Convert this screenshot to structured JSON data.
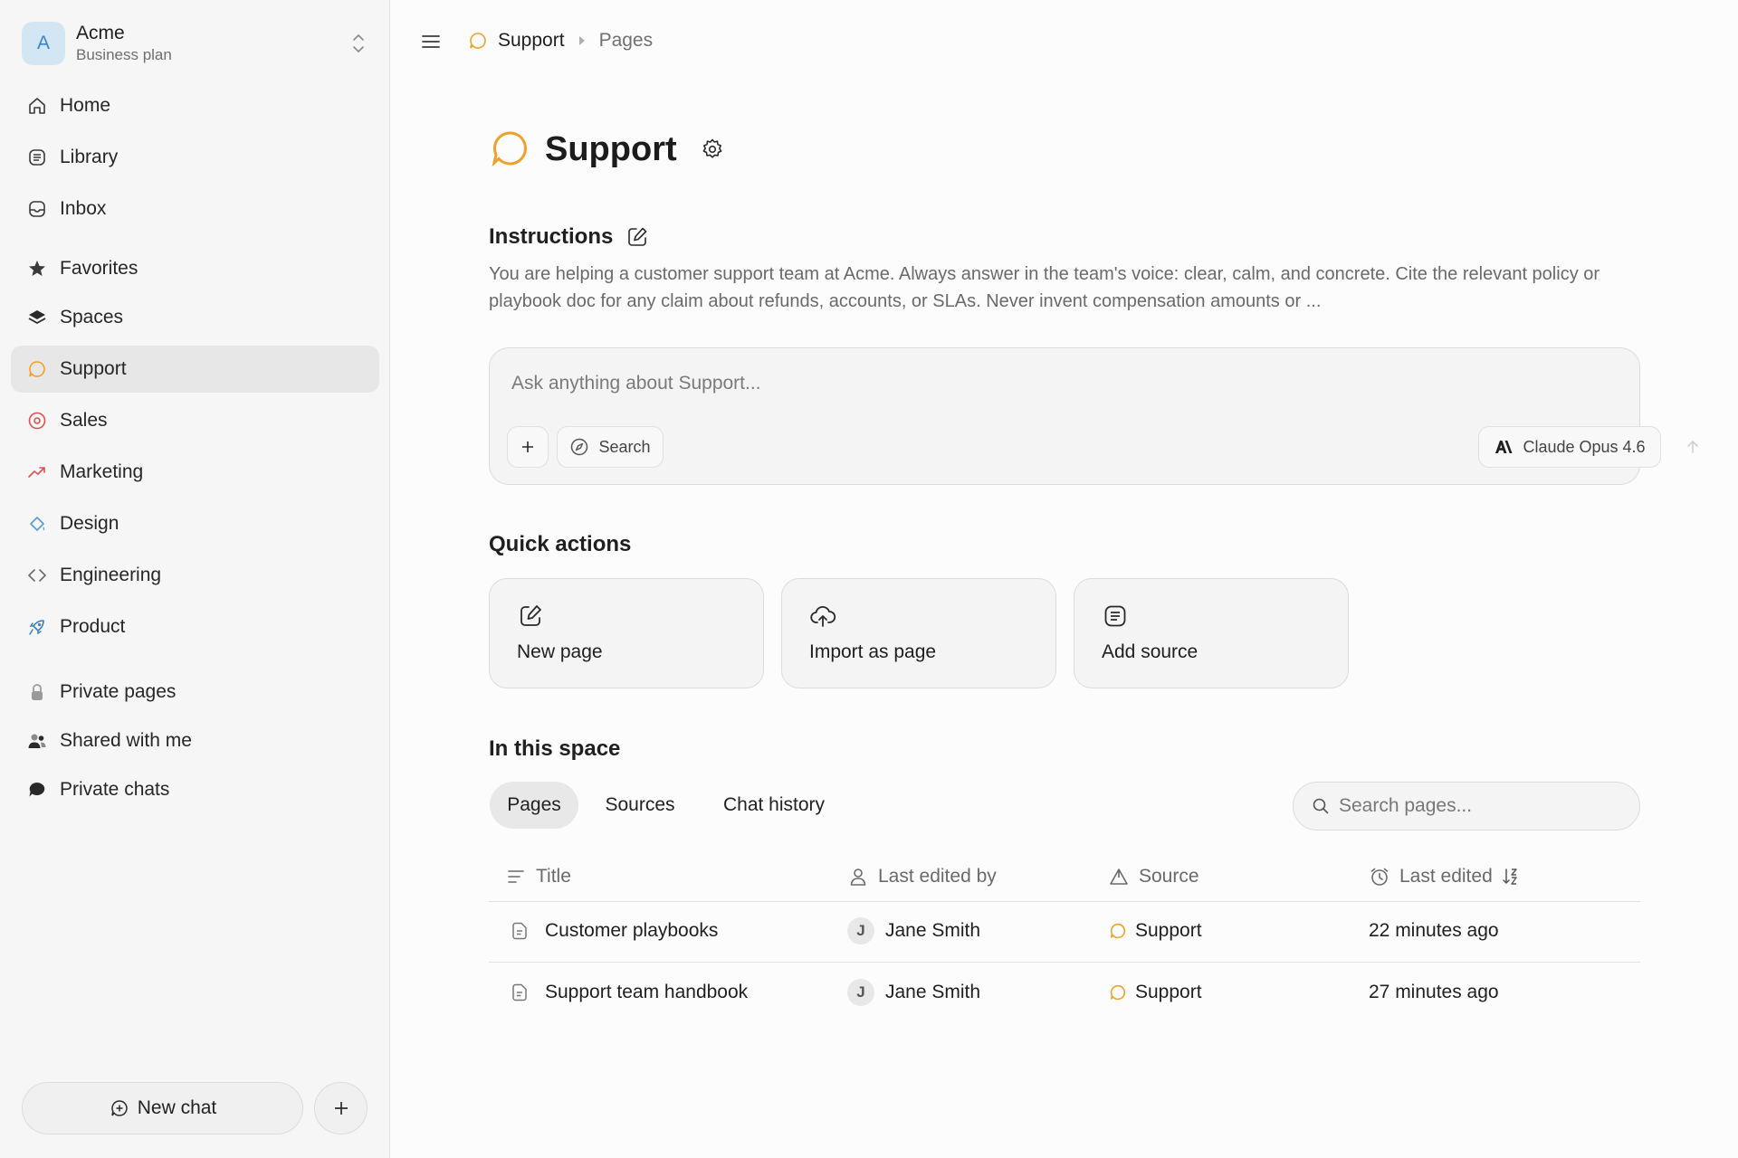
{
  "workspace": {
    "avatar_letter": "A",
    "name": "Acme",
    "plan": "Business plan"
  },
  "sidebar": {
    "items": [
      {
        "label": "Home",
        "icon": "home-icon"
      },
      {
        "label": "Library",
        "icon": "library-icon"
      },
      {
        "label": "Inbox",
        "icon": "inbox-icon"
      },
      {
        "label": "Favorites",
        "icon": "star-icon"
      },
      {
        "label": "Spaces",
        "icon": "layers-icon"
      },
      {
        "label": "Support",
        "icon": "chat-bubble-icon",
        "active": true
      },
      {
        "label": "Sales",
        "icon": "target-icon"
      },
      {
        "label": "Marketing",
        "icon": "trend-up-icon"
      },
      {
        "label": "Design",
        "icon": "paint-icon"
      },
      {
        "label": "Engineering",
        "icon": "code-icon"
      },
      {
        "label": "Product",
        "icon": "rocket-icon"
      },
      {
        "label": "Private pages",
        "icon": "lock-icon"
      },
      {
        "label": "Shared with me",
        "icon": "users-icon"
      },
      {
        "label": "Private chats",
        "icon": "chat-filled-icon"
      }
    ],
    "new_chat_label": "New chat"
  },
  "breadcrumb": {
    "space": "Support",
    "page": "Pages"
  },
  "space": {
    "title": "Support"
  },
  "instructions": {
    "heading": "Instructions",
    "text": "You are helping a customer support team at Acme. Always answer in the team's voice: clear, calm, and concrete. Cite the relevant policy or playbook doc for any claim about refunds, accounts, or SLAs. Never invent compensation amounts or ..."
  },
  "composer": {
    "placeholder": "Ask anything about Support...",
    "search_label": "Search",
    "model_label": "Claude Opus 4.6"
  },
  "quick_actions": {
    "heading": "Quick actions",
    "items": [
      {
        "label": "New page",
        "icon": "edit-page-icon"
      },
      {
        "label": "Import as page",
        "icon": "cloud-upload-icon"
      },
      {
        "label": "Add source",
        "icon": "library-icon"
      }
    ]
  },
  "in_space": {
    "heading": "In this space",
    "tabs": [
      "Pages",
      "Sources",
      "Chat history"
    ],
    "active_tab": "Pages",
    "search_placeholder": "Search pages..."
  },
  "table": {
    "columns": [
      "Title",
      "Last edited by",
      "Source",
      "Last edited"
    ],
    "rows": [
      {
        "title": "Customer playbooks",
        "editor_initial": "J",
        "editor": "Jane Smith",
        "source": "Support",
        "edited": "22 minutes ago"
      },
      {
        "title": "Support team handbook",
        "editor_initial": "J",
        "editor": "Jane Smith",
        "source": "Support",
        "edited": "27 minutes ago"
      }
    ]
  },
  "colors": {
    "support_accent": "#f0a02c",
    "sales_accent": "#e05050",
    "active_bg": "#e7e7e7"
  }
}
